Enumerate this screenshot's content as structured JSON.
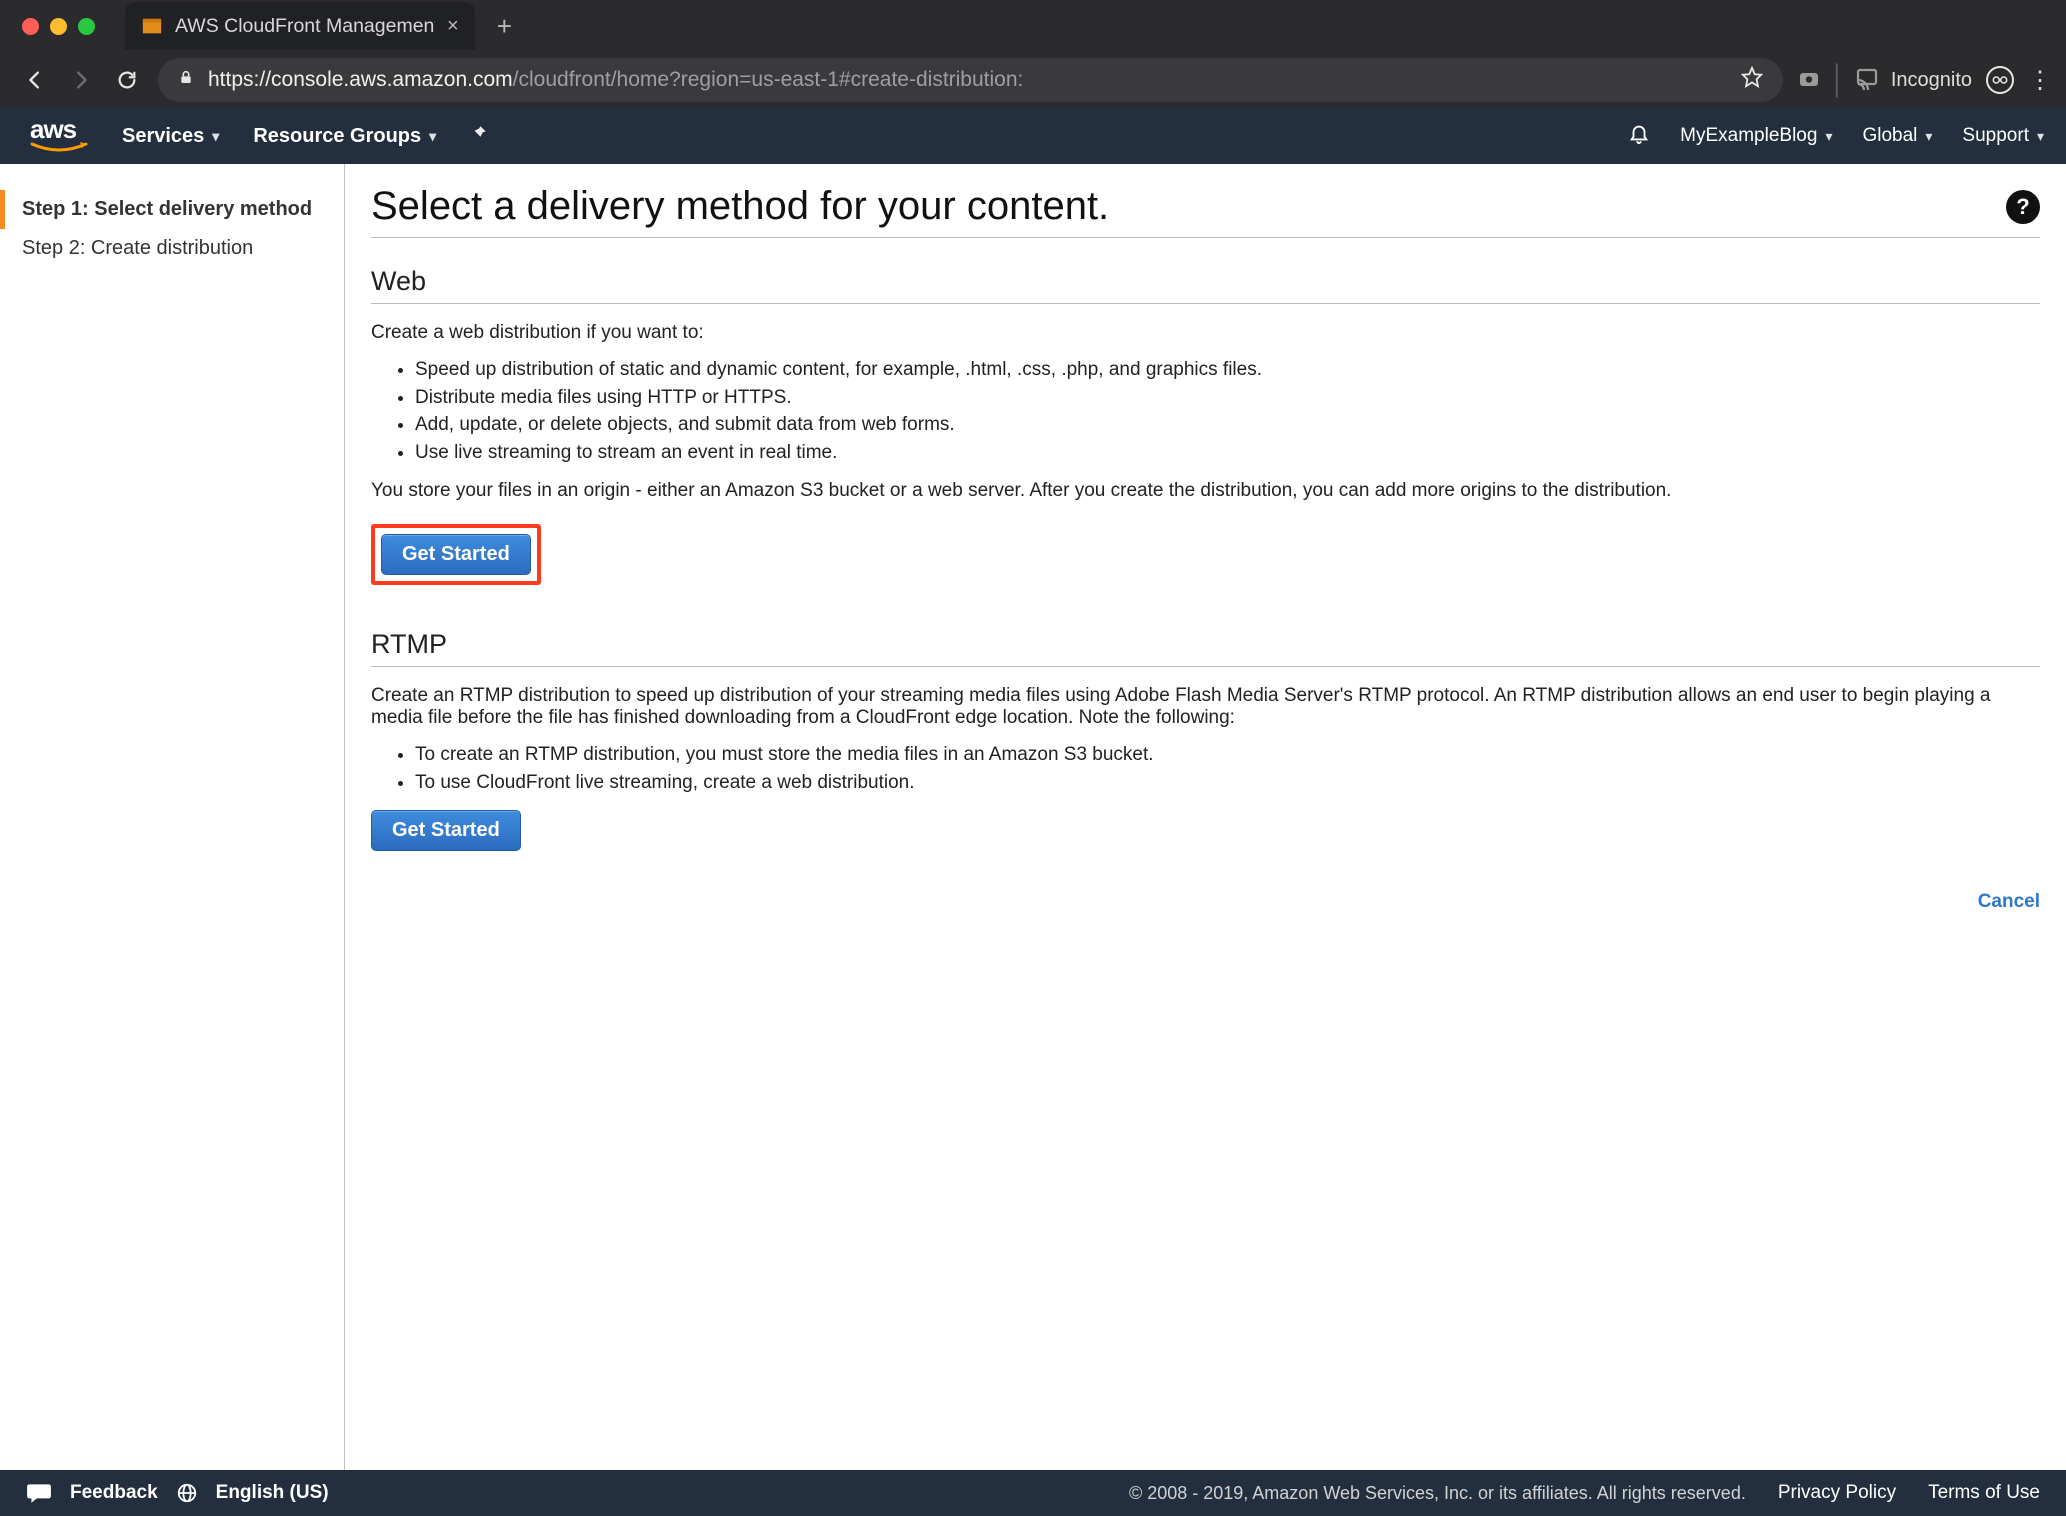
{
  "browser": {
    "tab_title": "AWS CloudFront Management",
    "url_host": "https://console.aws.amazon.com",
    "url_path": "/cloudfront/home?region=us-east-1#create-distribution:",
    "incognito_label": "Incognito"
  },
  "aws_nav": {
    "services": "Services",
    "resource_groups": "Resource Groups",
    "account": "MyExampleBlog",
    "region": "Global",
    "support": "Support"
  },
  "sidebar": {
    "step1": "Step 1: Select delivery method",
    "step2": "Step 2: Create distribution"
  },
  "page": {
    "title": "Select a delivery method for your content."
  },
  "web": {
    "heading": "Web",
    "intro": "Create a web distribution if you want to:",
    "bullets": [
      "Speed up distribution of static and dynamic content, for example, .html, .css, .php, and graphics files.",
      "Distribute media files using HTTP or HTTPS.",
      "Add, update, or delete objects, and submit data from web forms.",
      "Use live streaming to stream an event in real time."
    ],
    "outro": "You store your files in an origin - either an Amazon S3 bucket or a web server. After you create the distribution, you can add more origins to the distribution.",
    "button": "Get Started"
  },
  "rtmp": {
    "heading": "RTMP",
    "intro": "Create an RTMP distribution to speed up distribution of your streaming media files using Adobe Flash Media Server's RTMP protocol. An RTMP distribution allows an end user to begin playing a media file before the file has finished downloading from a CloudFront edge location. Note the following:",
    "bullets": [
      "To create an RTMP distribution, you must store the media files in an Amazon S3 bucket.",
      "To use CloudFront live streaming, create a web distribution."
    ],
    "button": "Get Started"
  },
  "cancel": "Cancel",
  "footer": {
    "feedback": "Feedback",
    "language": "English (US)",
    "copyright": "© 2008 - 2019, Amazon Web Services, Inc. or its affiliates. All rights reserved.",
    "privacy": "Privacy Policy",
    "terms": "Terms of Use"
  }
}
